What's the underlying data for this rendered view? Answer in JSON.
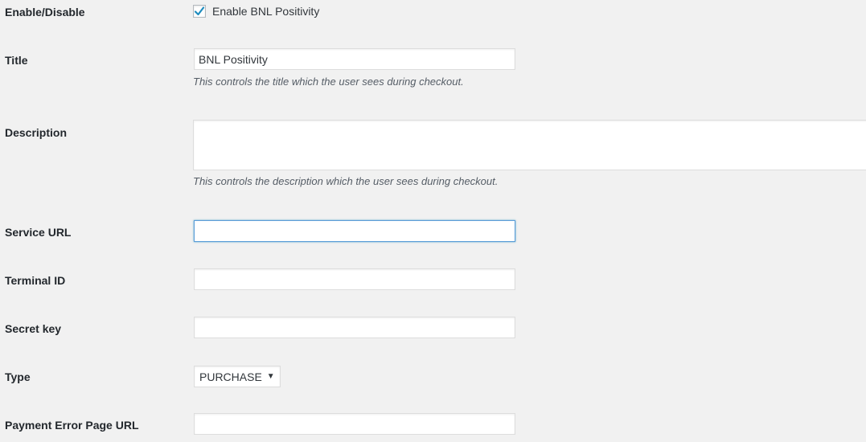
{
  "fields": {
    "enable": {
      "label": "Enable/Disable",
      "checkbox_label": "Enable BNL Positivity",
      "checked": true
    },
    "title": {
      "label": "Title",
      "value": "BNL Positivity",
      "help": "This controls the title which the user sees during checkout."
    },
    "description": {
      "label": "Description",
      "value": "",
      "help": "This controls the description which the user sees during checkout."
    },
    "service_url": {
      "label": "Service URL",
      "value": ""
    },
    "terminal_id": {
      "label": "Terminal ID",
      "value": ""
    },
    "secret_key": {
      "label": "Secret key",
      "value": ""
    },
    "type": {
      "label": "Type",
      "selected": "PURCHASE"
    },
    "payment_error_url": {
      "label": "Payment Error Page URL",
      "value": ""
    }
  },
  "colors": {
    "background": "#f1f1f1",
    "checkmark": "#1e8cbe",
    "focus_border": "#5b9dd9"
  }
}
